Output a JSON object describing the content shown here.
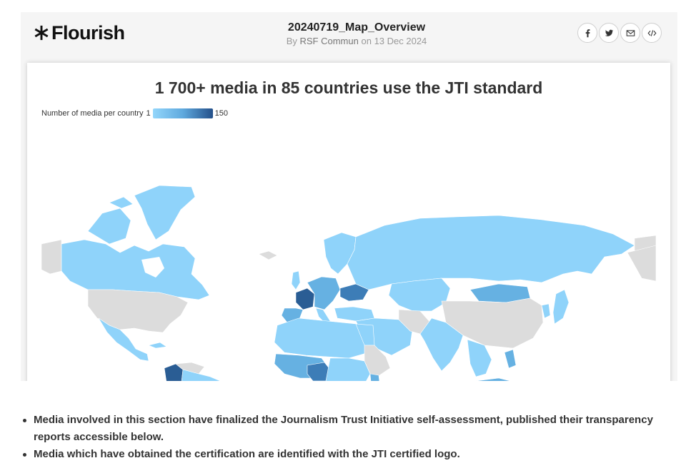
{
  "flourish": {
    "logo_text": "Flourish",
    "viz_name": "20240719_Map_Overview",
    "by_label": "By",
    "author": "RSF Commun",
    "on_label": "on",
    "date": "13 Dec 2024",
    "share_icons": [
      "facebook-icon",
      "twitter-icon",
      "email-icon",
      "embed-code-icon"
    ]
  },
  "chart": {
    "title": "1 700+ media in 85 countries use the JTI standard",
    "legend": {
      "label": "Number of media per country",
      "min": "1",
      "max": "150"
    }
  },
  "chart_data": {
    "type": "choropleth",
    "title": "1 700+ media in 85 countries use the JTI standard",
    "color_scale": {
      "min": 1,
      "max": 150,
      "colors": [
        "#93d6fb",
        "#5fa9de",
        "#24508a"
      ],
      "no_data_color": "#dcdcdc"
    }
  },
  "colors": {
    "light": "#8fd3fa",
    "mid": "#66b1e2",
    "dark": "#3d7db7",
    "darkest": "#2a5d94",
    "nodata": "#dcdcdc"
  },
  "bullets": [
    "Media involved in this section have finalized the Journalism Trust Initiative self-assessment, published their transparency reports accessible below.",
    "Media which have obtained the certification are identified with the JTI certified logo."
  ]
}
